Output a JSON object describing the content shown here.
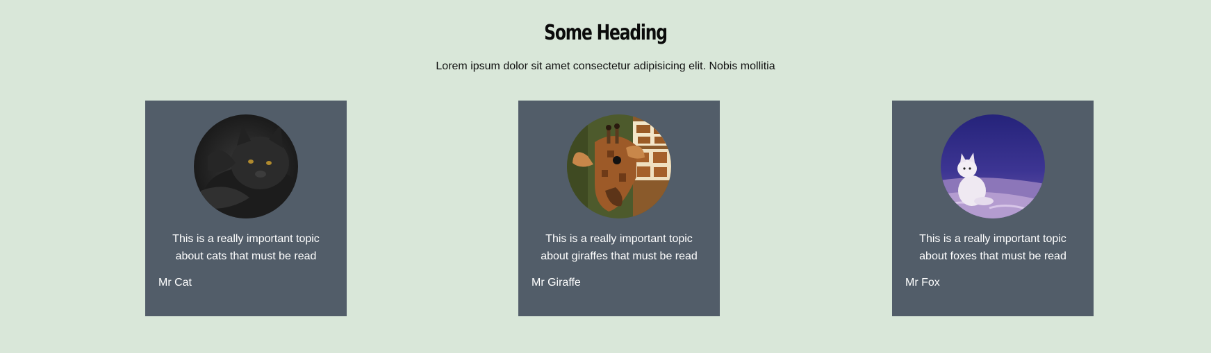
{
  "header": {
    "title": "Some Heading",
    "subtitle": "Lorem ipsum dolor sit amet consectetur adipisicing elit. Nobis mollitia"
  },
  "cards": [
    {
      "image": "cat-photo",
      "text": "This is a really important topic about cats that must be read",
      "author": "Mr Cat"
    },
    {
      "image": "giraffe-photo",
      "text": "This is a really important topic about giraffes that must be read",
      "author": "Mr Giraffe"
    },
    {
      "image": "fox-photo",
      "text": "This is a really important topic about foxes that must be read",
      "author": "Mr Fox"
    }
  ],
  "colors": {
    "page_background": "#d9e7d9",
    "card_background": "#525d69",
    "card_text": "#ffffff"
  }
}
